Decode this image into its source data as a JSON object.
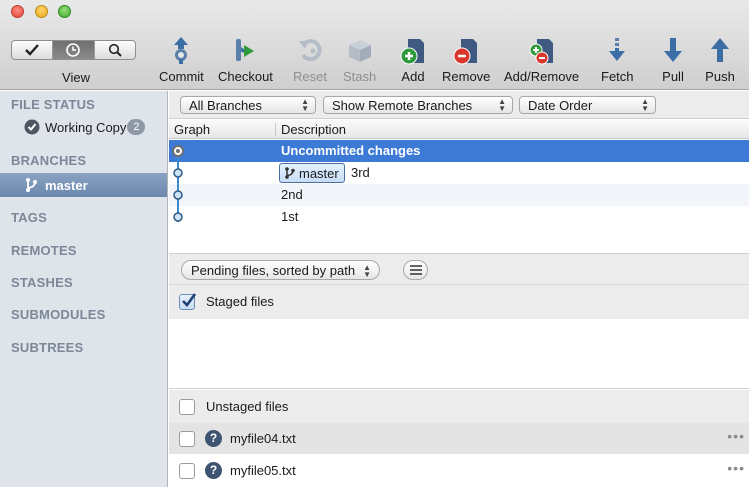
{
  "toolbar": {
    "view": {
      "label": "View",
      "segments": [
        {
          "icon": "checkmark-icon"
        },
        {
          "icon": "clock-icon",
          "active": true
        },
        {
          "icon": "search-icon"
        }
      ]
    },
    "buttons": [
      {
        "id": "commit",
        "label": "Commit",
        "icon": "commit-icon"
      },
      {
        "id": "checkout",
        "label": "Checkout",
        "icon": "checkout-icon"
      },
      {
        "id": "reset",
        "label": "Reset",
        "icon": "reset-icon",
        "disabled": true
      },
      {
        "id": "stash",
        "label": "Stash",
        "icon": "stash-icon",
        "disabled": true
      },
      {
        "id": "add",
        "label": "Add",
        "icon": "add-icon"
      },
      {
        "id": "remove",
        "label": "Remove",
        "icon": "remove-icon"
      },
      {
        "id": "add_remove",
        "label": "Add/Remove",
        "icon": "add-remove-icon"
      },
      {
        "id": "fetch",
        "label": "Fetch",
        "icon": "fetch-icon"
      },
      {
        "id": "pull",
        "label": "Pull",
        "icon": "pull-icon"
      },
      {
        "id": "push",
        "label": "Push",
        "icon": "push-icon"
      }
    ]
  },
  "sidebar": {
    "file_status": {
      "header": "FILE STATUS",
      "item_label": "Working Copy",
      "badge": "2"
    },
    "branches": {
      "header": "BRANCHES",
      "item_label": "master"
    },
    "sections": [
      "TAGS",
      "REMOTES",
      "STASHES",
      "SUBMODULES",
      "SUBTREES"
    ]
  },
  "filters": {
    "branches": "All Branches",
    "remote": "Show Remote Branches",
    "order": "Date Order"
  },
  "history": {
    "columns": {
      "graph": "Graph",
      "description": "Description"
    },
    "rows": [
      {
        "description": "Uncommitted changes"
      },
      {
        "tag": "master",
        "description": "3rd"
      },
      {
        "description": "2nd"
      },
      {
        "description": "1st"
      }
    ]
  },
  "pending": {
    "sort_label": "Pending files, sorted by path",
    "staged_label": "Staged files",
    "unstaged_label": "Unstaged files",
    "files": [
      {
        "name": "myfile04.txt",
        "status_icon": "question-icon"
      },
      {
        "name": "myfile05.txt",
        "status_icon": "question-icon"
      }
    ]
  },
  "colors": {
    "selection": "#3d7ad6",
    "sidebar_bg": "#dfe4eb",
    "sidebar_header": "#7c8797",
    "graph_line": "#3a8ad0"
  }
}
